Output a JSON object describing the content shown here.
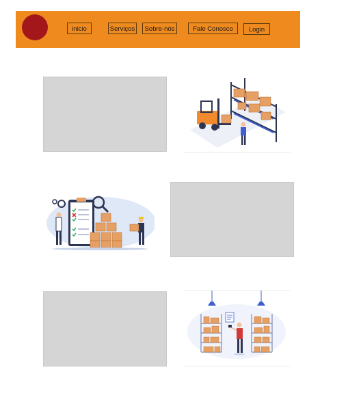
{
  "header": {
    "logo_color": "#a3171a",
    "background_color": "#ef8a1f",
    "nav": {
      "inicio": "inicio",
      "servicos": "Serviços",
      "sobre": "Sobre-nós",
      "fale": "Fale Conosco",
      "login": "Login"
    }
  },
  "content": {
    "placeholder_color": "#d5d5d5",
    "illustrations": [
      {
        "icon": "forklift-warehouse-illustration"
      },
      {
        "icon": "inventory-checklist-illustration"
      },
      {
        "icon": "warehouse-shelves-illustration"
      }
    ]
  }
}
